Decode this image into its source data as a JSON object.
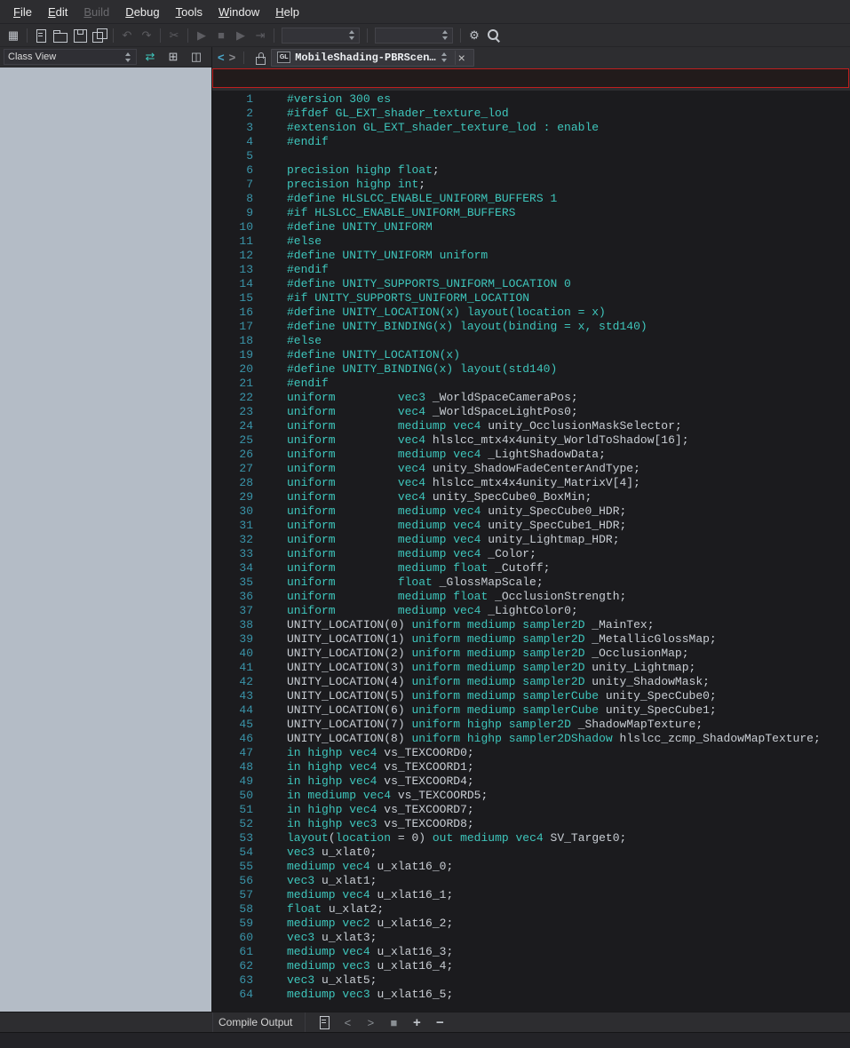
{
  "menu": {
    "items": [
      {
        "label": "File",
        "enabled": true
      },
      {
        "label": "Edit",
        "enabled": true
      },
      {
        "label": "Build",
        "enabled": false
      },
      {
        "label": "Debug",
        "enabled": true
      },
      {
        "label": "Tools",
        "enabled": true
      },
      {
        "label": "Window",
        "enabled": true
      },
      {
        "label": "Help",
        "enabled": true
      }
    ]
  },
  "toolbar": {
    "groups": [
      {
        "items": [
          {
            "name": "layout-panels-icon",
            "glyph": "▦"
          }
        ]
      },
      {
        "items": [
          {
            "name": "new-file-icon",
            "shape": "file"
          },
          {
            "name": "open-folder-icon",
            "shape": "folder"
          },
          {
            "name": "save-icon",
            "shape": "save"
          },
          {
            "name": "save-all-icon",
            "shape": "saveall"
          }
        ]
      },
      {
        "items": [
          {
            "name": "undo-icon",
            "glyph": "↶",
            "enabled": false
          },
          {
            "name": "redo-icon",
            "glyph": "↷",
            "enabled": false
          }
        ]
      },
      {
        "items": [
          {
            "name": "cut-icon",
            "glyph": "✂",
            "enabled": false
          }
        ]
      },
      {
        "items": [
          {
            "name": "debug-continue-icon",
            "glyph": "▶",
            "enabled": false
          },
          {
            "name": "stop-debug-icon",
            "glyph": "■",
            "enabled": false
          },
          {
            "name": "run-icon",
            "glyph": "▶",
            "enabled": false
          },
          {
            "name": "step-over-icon",
            "glyph": "⇥",
            "enabled": false
          }
        ]
      },
      {
        "items": [
          {
            "name": "config-combobox",
            "kind": "combo",
            "value": ""
          }
        ]
      },
      {
        "items": [
          {
            "name": "platform-combobox",
            "kind": "combo",
            "value": ""
          }
        ]
      },
      {
        "items": [
          {
            "name": "settings-gear-icon",
            "glyph": "⚙"
          },
          {
            "name": "search-icon",
            "shape": "search"
          }
        ]
      }
    ]
  },
  "left_panel": {
    "title": "Class View",
    "sync_glyph": "⇄",
    "add_glyph": "⊞",
    "split_glyph": "◫"
  },
  "tab_bar": {
    "back_glyph": "<",
    "forward_glyph": ">",
    "badge": "GL",
    "title": "MobileShading-PBRScen…",
    "close_glyph": "×"
  },
  "editor": {
    "keywords": [
      "precision",
      "highp",
      "mediump",
      "uniform",
      "in",
      "out",
      "layout",
      "location",
      "binding",
      "std140",
      "enable",
      "float",
      "int",
      "vec2",
      "vec3",
      "vec4",
      "sampler2D",
      "samplerCube",
      "sampler2DShadow"
    ],
    "lines": [
      "#version 300 es",
      "#ifdef GL_EXT_shader_texture_lod",
      "#extension GL_EXT_shader_texture_lod : enable",
      "#endif",
      "",
      "precision highp float;",
      "precision highp int;",
      "#define HLSLCC_ENABLE_UNIFORM_BUFFERS 1",
      "#if HLSLCC_ENABLE_UNIFORM_BUFFERS",
      "#define UNITY_UNIFORM",
      "#else",
      "#define UNITY_UNIFORM uniform",
      "#endif",
      "#define UNITY_SUPPORTS_UNIFORM_LOCATION 0",
      "#if UNITY_SUPPORTS_UNIFORM_LOCATION",
      "#define UNITY_LOCATION(x) layout(location = x)",
      "#define UNITY_BINDING(x) layout(binding = x, std140)",
      "#else",
      "#define UNITY_LOCATION(x)",
      "#define UNITY_BINDING(x) layout(std140)",
      "#endif",
      "uniform \tvec3 _WorldSpaceCameraPos;",
      "uniform \tvec4 _WorldSpaceLightPos0;",
      "uniform \tmediump vec4 unity_OcclusionMaskSelector;",
      "uniform \tvec4 hlslcc_mtx4x4unity_WorldToShadow[16];",
      "uniform \tmediump vec4 _LightShadowData;",
      "uniform \tvec4 unity_ShadowFadeCenterAndType;",
      "uniform \tvec4 hlslcc_mtx4x4unity_MatrixV[4];",
      "uniform \tvec4 unity_SpecCube0_BoxMin;",
      "uniform \tmediump vec4 unity_SpecCube0_HDR;",
      "uniform \tmediump vec4 unity_SpecCube1_HDR;",
      "uniform \tmediump vec4 unity_Lightmap_HDR;",
      "uniform \tmediump vec4 _Color;",
      "uniform \tmediump float _Cutoff;",
      "uniform \tfloat _GlossMapScale;",
      "uniform \tmediump float _OcclusionStrength;",
      "uniform \tmediump vec4 _LightColor0;",
      "UNITY_LOCATION(0) uniform mediump sampler2D _MainTex;",
      "UNITY_LOCATION(1) uniform mediump sampler2D _MetallicGlossMap;",
      "UNITY_LOCATION(2) uniform mediump sampler2D _OcclusionMap;",
      "UNITY_LOCATION(3) uniform mediump sampler2D unity_Lightmap;",
      "UNITY_LOCATION(4) uniform mediump sampler2D unity_ShadowMask;",
      "UNITY_LOCATION(5) uniform mediump samplerCube unity_SpecCube0;",
      "UNITY_LOCATION(6) uniform mediump samplerCube unity_SpecCube1;",
      "UNITY_LOCATION(7) uniform highp sampler2D _ShadowMapTexture;",
      "UNITY_LOCATION(8) uniform highp sampler2DShadow hlslcc_zcmp_ShadowMapTexture;",
      "in highp vec4 vs_TEXCOORD0;",
      "in highp vec4 vs_TEXCOORD1;",
      "in highp vec4 vs_TEXCOORD4;",
      "in mediump vec4 vs_TEXCOORD5;",
      "in highp vec4 vs_TEXCOORD7;",
      "in highp vec3 vs_TEXCOORD8;",
      "layout(location = 0) out mediump vec4 SV_Target0;",
      "vec3 u_xlat0;",
      "mediump vec4 u_xlat16_0;",
      "vec3 u_xlat1;",
      "mediump vec4 u_xlat16_1;",
      "float u_xlat2;",
      "mediump vec2 u_xlat16_2;",
      "vec3 u_xlat3;",
      "mediump vec4 u_xlat16_3;",
      "mediump vec3 u_xlat16_4;",
      "vec3 u_xlat5;",
      "mediump vec3 u_xlat16_5;"
    ]
  },
  "bottom_bar": {
    "label": "Compile Output",
    "icons": [
      {
        "name": "export-output-icon",
        "shape": "file"
      },
      {
        "name": "prev-message-icon",
        "glyph": "<",
        "dim": true
      },
      {
        "name": "next-message-icon",
        "glyph": ">",
        "dim": true
      },
      {
        "name": "stop-build-icon",
        "glyph": "■",
        "dim": true
      },
      {
        "name": "zoom-in-icon",
        "glyph": "+",
        "big": true
      },
      {
        "name": "zoom-out-icon",
        "glyph": "−",
        "big": true
      }
    ]
  },
  "colors": {
    "keyword": "#3ec6bc",
    "identifier": "#c9ced4",
    "line_number": "#3a95aa",
    "error_red": "#c01e1e",
    "editor_bg": "#1b1b1e",
    "chrome_bg": "#2d2d30",
    "panel_bg": "#b4bcc6",
    "accent": "#3ec6bc"
  }
}
